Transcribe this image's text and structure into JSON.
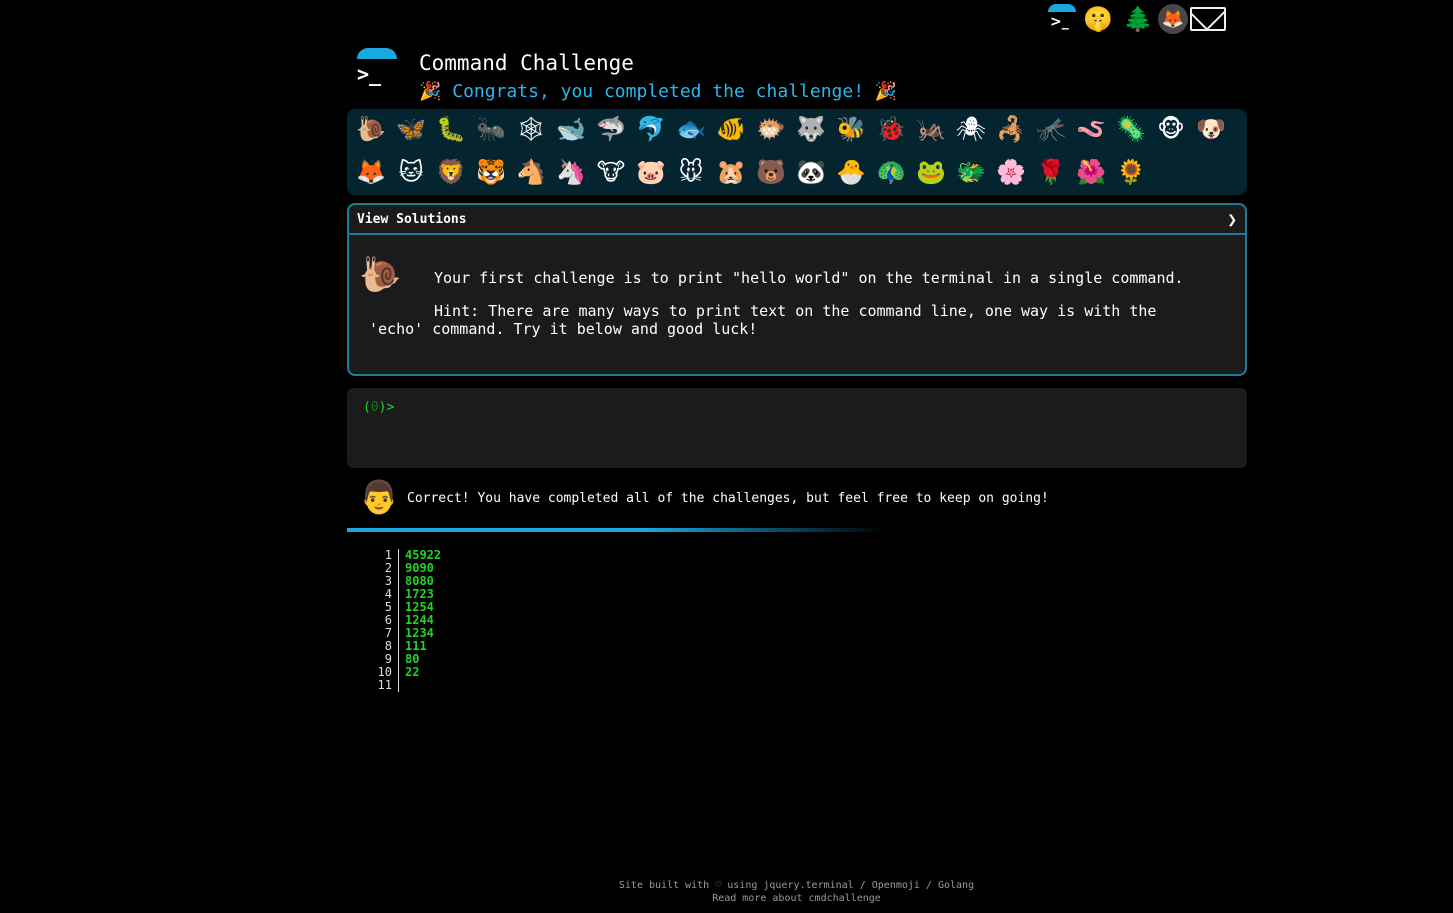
{
  "top_links": [
    {
      "name": "cmdchallenge-logo-icon"
    },
    {
      "name": "shushing-face-icon",
      "glyph": "🤫"
    },
    {
      "name": "tree-icon",
      "glyph": "🌲"
    },
    {
      "name": "gitlab-icon",
      "glyph": "🦊"
    },
    {
      "name": "mail-icon",
      "glyph": "✉"
    }
  ],
  "header": {
    "logo_prompt": ">_",
    "title": "Command Challenge",
    "congrats": "🎉 Congrats, you completed the challenge! 🎉"
  },
  "emoji_rows": [
    [
      "🐌",
      "🦋",
      "🐛",
      "🐜",
      "🕸",
      "🐋",
      "🦈",
      "🐬",
      "🐟",
      "🐠",
      "🐡",
      "🐺",
      "🐝",
      "🐞",
      "🦗",
      "🕷",
      "🦂",
      "🦟",
      "🪱",
      "🦠",
      "🐵",
      "🐶"
    ],
    [
      "🦊",
      "🐱",
      "🦁",
      "🐯",
      "🐴",
      "🦄",
      "🐮",
      "🐷",
      "🐭",
      "🐹",
      "🐻",
      "🐼",
      "🐣",
      "🦚",
      "🐸",
      "🐲",
      "🌸",
      "🌹",
      "🌺",
      "🌻"
    ]
  ],
  "solutions": {
    "label": "View Solutions",
    "chevron": "❯",
    "snail": "🐌",
    "challenge_text": "Your first challenge is to print \"hello world\" on the terminal in a single command.",
    "hint_text": "Hint: There are many ways to print text on the command line, one way is with the 'echo' command. Try it below and good luck!"
  },
  "terminal": {
    "prompt_open": "(",
    "prompt_status": "0",
    "prompt_close": ")>"
  },
  "result": {
    "avatar": "👨",
    "message": "Correct! You have completed all of the challenges, but feel free to keep on going!"
  },
  "output_lines": {
    "numbers": [
      "1",
      "2",
      "3",
      "4",
      "5",
      "6",
      "7",
      "8",
      "9",
      "10",
      "11"
    ],
    "values": [
      "45922",
      "9090",
      "8080",
      "1723",
      "1254",
      "1244",
      "1234",
      "111",
      "80",
      "22",
      ""
    ]
  },
  "footer": {
    "line1": "Site built with ♡ using jquery.terminal / Openmoji / Golang",
    "line2": "Read more about cmdchallenge"
  },
  "colors": {
    "accent": "#1aa8e0",
    "success": "#1fd41f",
    "panel": "#1b1b1b",
    "emoji_panel": "#042530"
  }
}
